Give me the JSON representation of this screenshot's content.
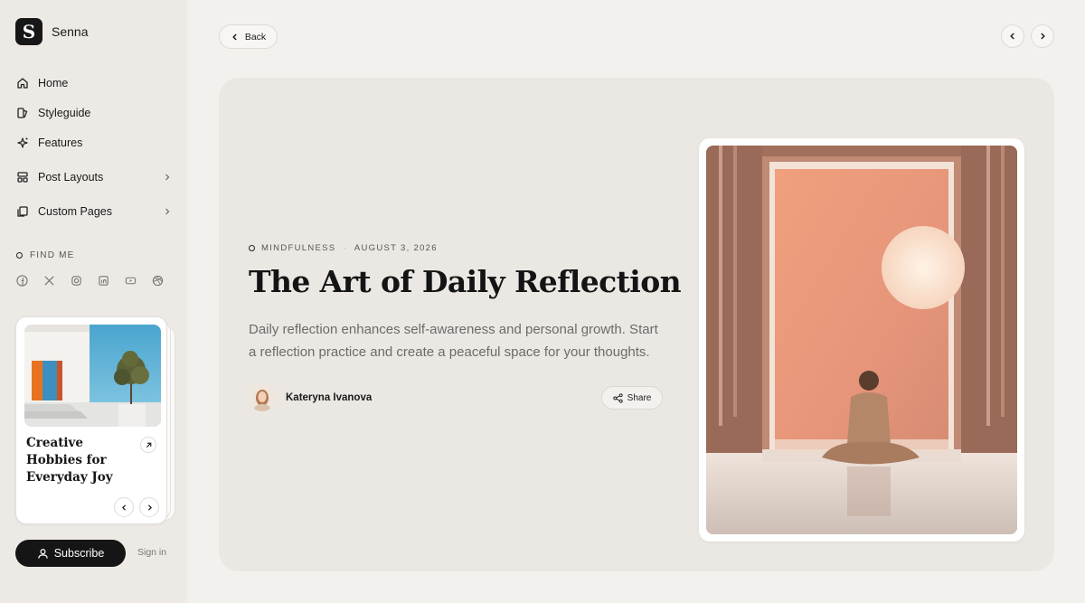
{
  "brand": {
    "logo_letter": "S",
    "name": "Senna"
  },
  "nav": {
    "items": [
      {
        "label": "Home",
        "icon": "home-icon"
      },
      {
        "label": "Styleguide",
        "icon": "styleguide-icon"
      },
      {
        "label": "Features",
        "icon": "sparkles-icon"
      },
      {
        "label": "Post Layouts",
        "icon": "layout-icon",
        "has_submenu": true
      },
      {
        "label": "Custom Pages",
        "icon": "pages-icon",
        "has_submenu": true
      }
    ]
  },
  "find_me": {
    "label": "FIND ME",
    "socials": [
      "facebook-icon",
      "x-icon",
      "instagram-icon",
      "linkedin-icon",
      "youtube-icon",
      "dribbble-icon"
    ]
  },
  "mini_card": {
    "title": "Creative Hobbies for Everyday Joy"
  },
  "subscribe": {
    "label": "Subscribe"
  },
  "signin": {
    "label": "Sign in"
  },
  "topbar": {
    "back_label": "Back"
  },
  "post": {
    "category": "MINDFULNESS",
    "separator": "·",
    "date": "AUGUST 3, 2026",
    "title": "The Art of Daily Reflection",
    "description": "Daily reflection enhances self-awareness and personal growth. Start a reflection practice and create a peaceful space for your thoughts.",
    "author": "Kateryna Ivanova",
    "share_label": "Share"
  },
  "colors": {
    "page_bg": "#f3f1ee",
    "sidebar_bg": "#edeae6",
    "hero_bg": "#ebe8e4",
    "primary_dark": "#151515",
    "accent_peach": "#e9a383"
  }
}
